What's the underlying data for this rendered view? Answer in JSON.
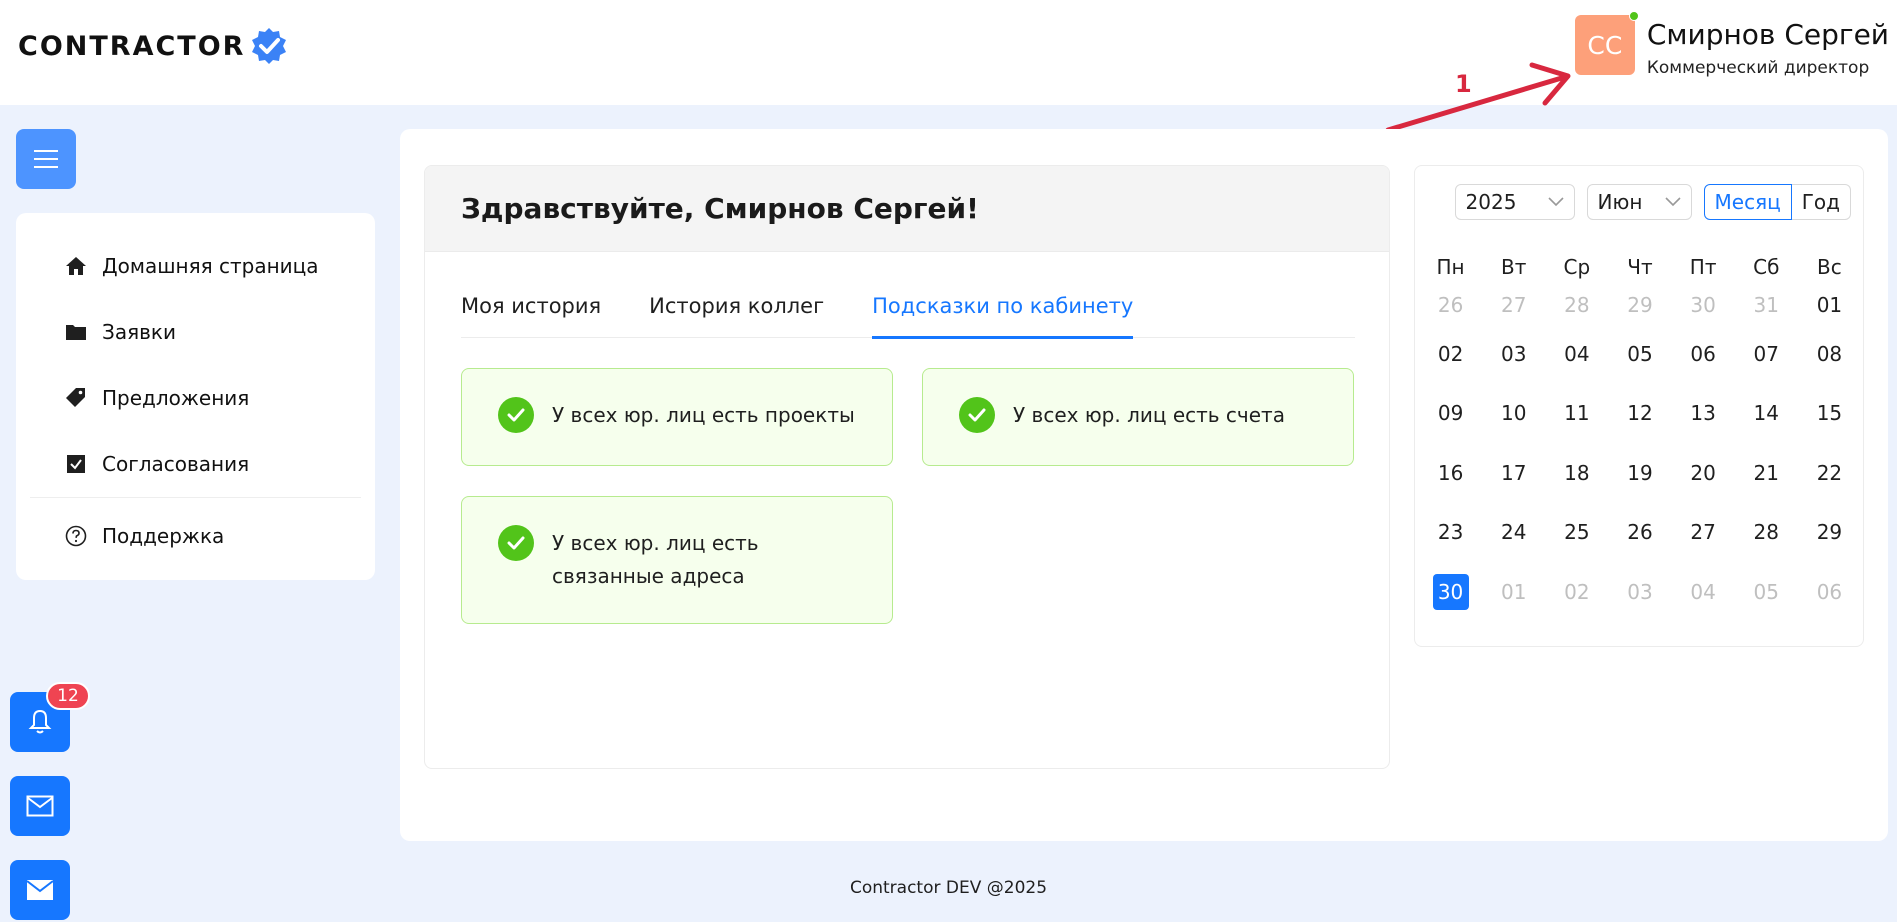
{
  "header": {
    "logo_text": "CONTRACTOR",
    "user": {
      "initials": "СС",
      "name": "Смирнов Сергей",
      "role": "Коммерческий директор",
      "online_color": "#52c41a"
    },
    "annotation_label": "1"
  },
  "sidebar": {
    "items": [
      {
        "label": "Домашняя страница",
        "icon": "home-icon"
      },
      {
        "label": "Заявки",
        "icon": "folder-icon"
      },
      {
        "label": "Предложения",
        "icon": "tags-icon"
      },
      {
        "label": "Согласования",
        "icon": "check-square-icon"
      }
    ],
    "support_label": "Поддержка"
  },
  "fabs": {
    "notifications_count": "12"
  },
  "welcome": {
    "title": "Здравствуйте, Смирнов Сергей!",
    "tabs": [
      {
        "label": "Моя история",
        "active": false
      },
      {
        "label": "История коллег",
        "active": false
      },
      {
        "label": "Подсказки по кабинету",
        "active": true
      }
    ],
    "hints": [
      "У всех юр. лиц есть проекты",
      "У всех юр. лиц есть счета",
      "У всех юр. лиц есть связанные адреса"
    ]
  },
  "calendar": {
    "year": "2025",
    "month": "Июн",
    "mode_month": "Месяц",
    "mode_year": "Год",
    "weekdays": [
      "Пн",
      "Вт",
      "Ср",
      "Чт",
      "Пт",
      "Сб",
      "Вс"
    ],
    "weeks": [
      [
        "26",
        "27",
        "28",
        "29",
        "30",
        "31",
        "01"
      ],
      [
        "02",
        "03",
        "04",
        "05",
        "06",
        "07",
        "08"
      ],
      [
        "09",
        "10",
        "11",
        "12",
        "13",
        "14",
        "15"
      ],
      [
        "16",
        "17",
        "18",
        "19",
        "20",
        "21",
        "22"
      ],
      [
        "23",
        "24",
        "25",
        "26",
        "27",
        "28",
        "29"
      ],
      [
        "30",
        "01",
        "02",
        "03",
        "04",
        "05",
        "06"
      ]
    ],
    "selected_day": "30",
    "accent": "#1677ff"
  },
  "footer": {
    "text": "Contractor DEV @2025"
  }
}
